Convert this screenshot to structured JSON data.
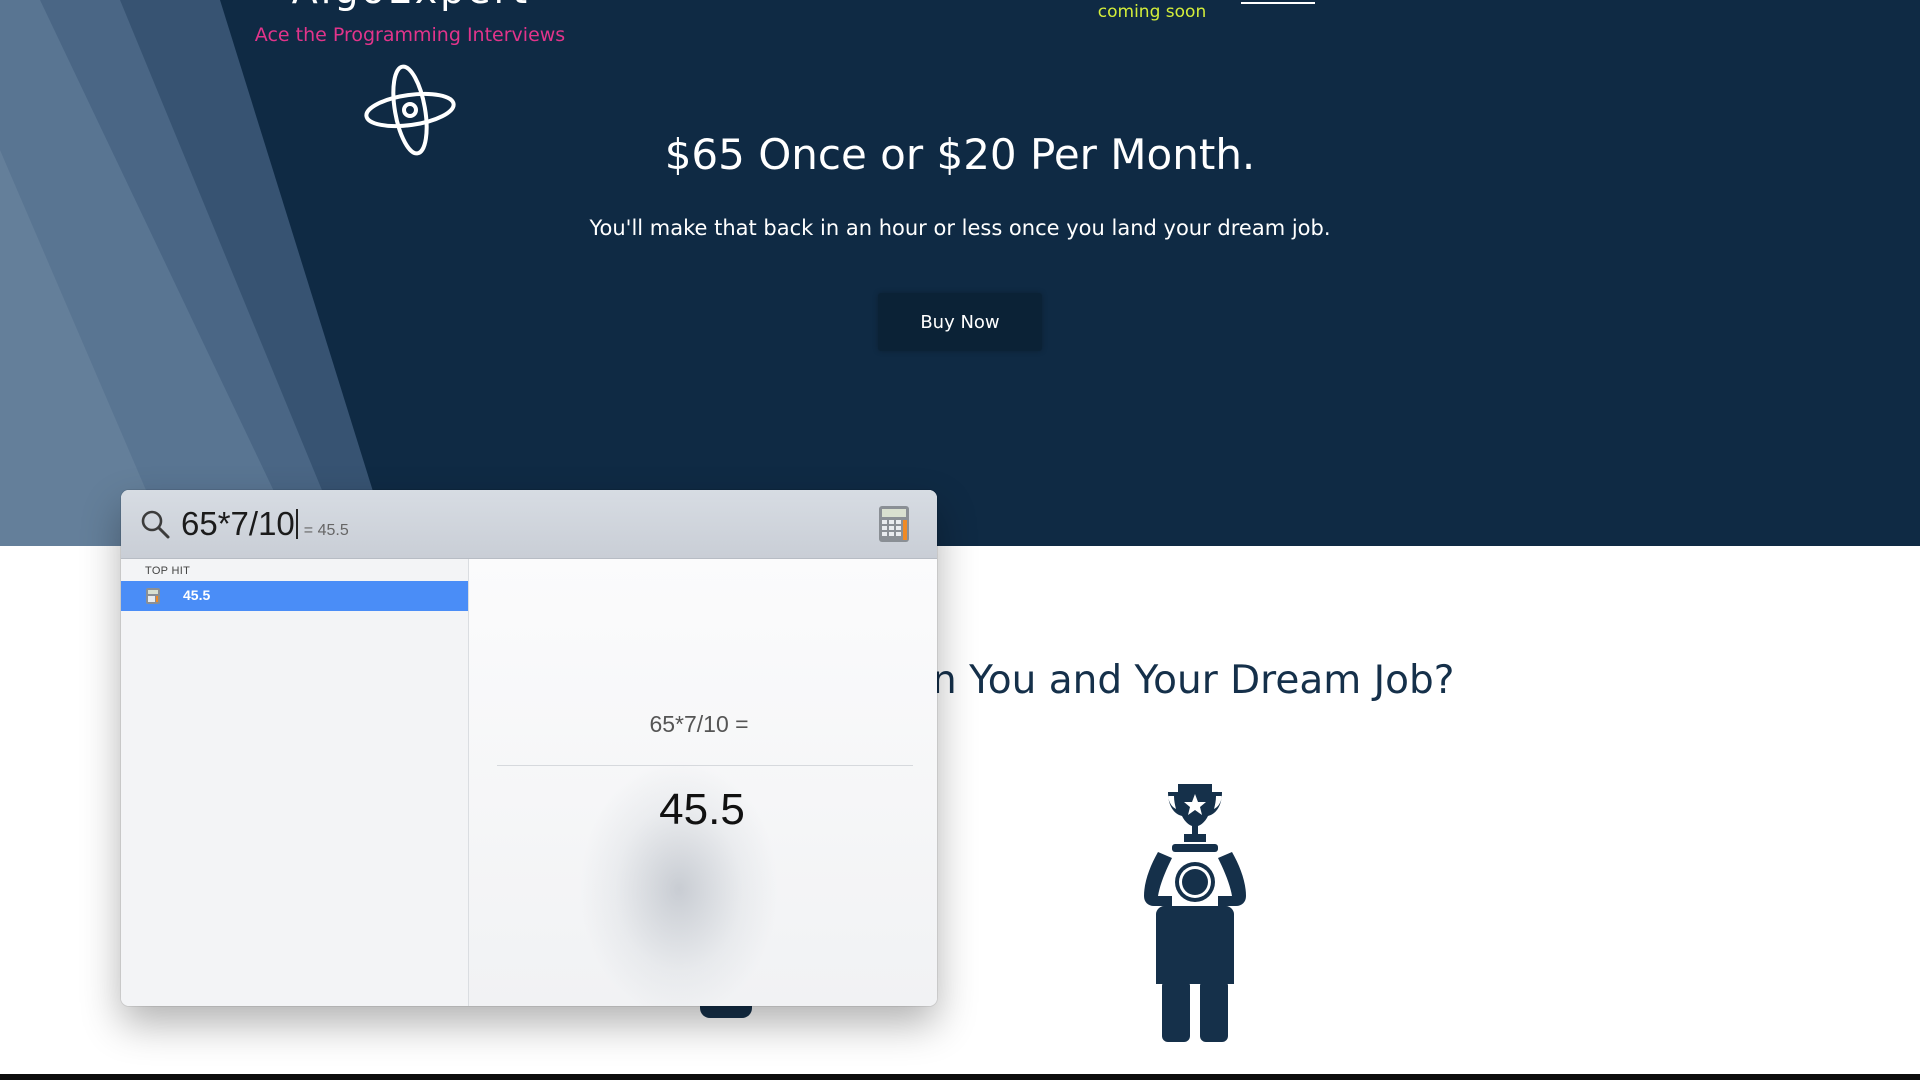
{
  "website": {
    "brand_name": "AlgoExpert",
    "tagline": "Ace the Programming Interviews",
    "nav_badge": "coming soon",
    "pricing_title": "$65 Once or $20 Per Month.",
    "pricing_subtitle": "You'll make that back in an hour or less once you land your dream job.",
    "buy_button_label": "Buy Now",
    "section_heading_visible": "n You and Your Dream Job?"
  },
  "spotlight": {
    "query": "65*7/10",
    "inline_result": "= 45.5",
    "section_label": "TOP HIT",
    "top_hit_label": "45.5",
    "preview_expression": "65*7/10 =",
    "preview_result": "45.5",
    "selection_color": "#4a8df7"
  },
  "colors": {
    "hero_background": "#0f2a44",
    "tagline": "#e2348b",
    "coming_soon": "#d4ee3a",
    "heading_text": "#15304a"
  },
  "icons": [
    "atom-logo-icon",
    "search-icon",
    "calculator-icon",
    "trophy-person-icon"
  ]
}
